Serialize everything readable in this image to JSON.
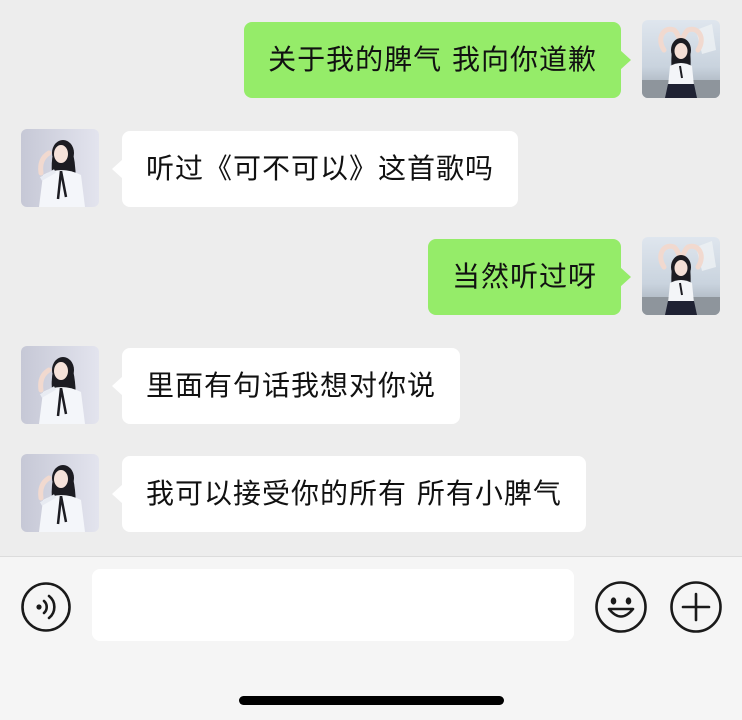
{
  "messages": [
    {
      "direction": "outgoing",
      "text": "关于我的脾气 我向你道歉",
      "avatar": "avatar-girl-heart-pose"
    },
    {
      "direction": "incoming",
      "text": "听过《可不可以》这首歌吗",
      "avatar": "avatar-girl-white-shirt"
    },
    {
      "direction": "outgoing",
      "text": "当然听过呀",
      "avatar": "avatar-girl-heart-pose"
    },
    {
      "direction": "incoming",
      "text": "里面有句话我想对你说",
      "avatar": "avatar-girl-white-shirt"
    },
    {
      "direction": "incoming",
      "text": "我可以接受你的所有 所有小脾气",
      "avatar": "avatar-girl-white-shirt"
    }
  ],
  "input_bar": {
    "value": "",
    "voice_icon": "voice-icon",
    "emoji_icon": "emoji-icon",
    "plus_icon": "plus-icon"
  },
  "colors": {
    "background": "#ededed",
    "outgoing_bubble": "#95ec69",
    "incoming_bubble": "#ffffff",
    "input_bar": "#f5f5f5"
  }
}
